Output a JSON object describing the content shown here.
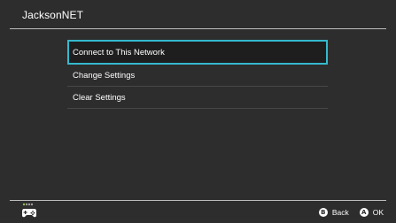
{
  "header": {
    "title": "JacksonNET"
  },
  "menu": {
    "items": [
      {
        "label": "Connect to This Network",
        "selected": true
      },
      {
        "label": "Change Settings",
        "selected": false
      },
      {
        "label": "Clear Settings",
        "selected": false
      }
    ]
  },
  "footer": {
    "controller_icon": "controller-icon",
    "back": {
      "glyph": "B",
      "label": "Back"
    },
    "ok": {
      "glyph": "A",
      "label": "OK"
    }
  },
  "colors": {
    "background": "#2d2d2d",
    "accent": "#35b9ce",
    "selected_bg": "#1e1e1e"
  }
}
